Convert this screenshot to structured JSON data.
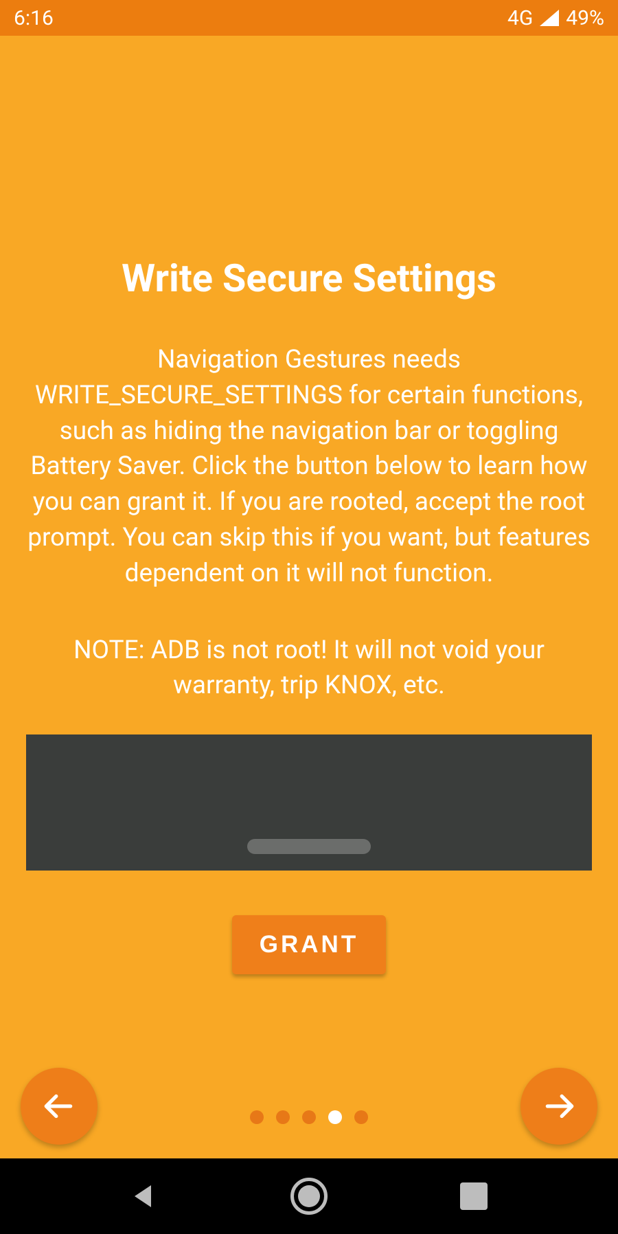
{
  "status": {
    "time": "6:16",
    "network_label": "4G",
    "battery": "49%"
  },
  "onboarding": {
    "title": "Write Secure Settings",
    "body": "Navigation Gestures needs WRITE_SECURE_SETTINGS for certain functions, such as hiding the navigation bar or toggling Battery Saver. Click the button below to learn how you can grant it. If you are rooted, accept the root prompt. You can skip this if you want, but features dependent on it will not function.",
    "note": "NOTE: ADB is not root! It will not void your warranty, trip KNOX, etc.",
    "grant_label": "GRANT",
    "page_count": 5,
    "active_page_index": 3
  }
}
